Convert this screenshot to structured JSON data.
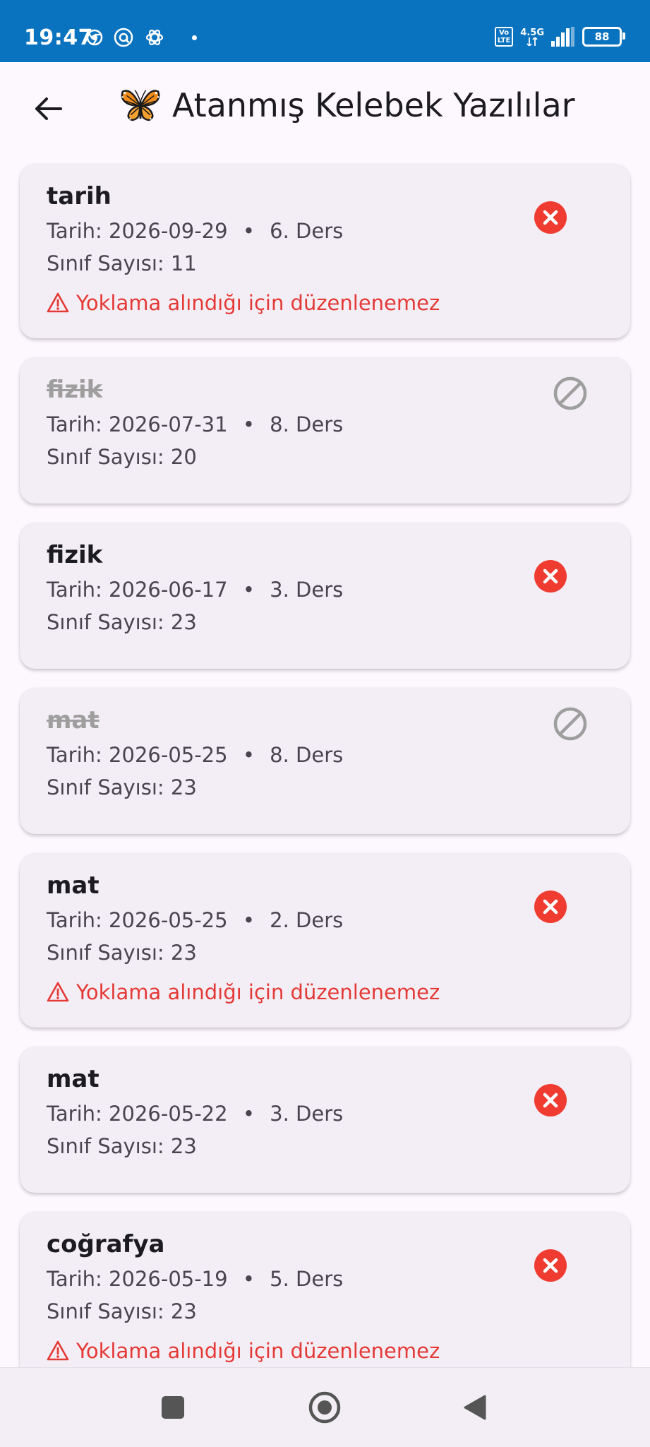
{
  "status_bar": {
    "time": "19:47",
    "network": "4.5G",
    "volte_top": "Vo",
    "volte_bottom": "LTE",
    "battery": "88"
  },
  "app_bar": {
    "title": "Atanmış Kelebek Yazılılar",
    "back_icon": "arrow-left-icon",
    "logo_icon": "butterfly-emoji"
  },
  "labels": {
    "date_prefix": "Tarih:",
    "class_count_prefix": "Sınıf Sayısı:",
    "separator": "•",
    "warning": "Yoklama alındığı için düzenlenemez"
  },
  "exams": [
    {
      "subject": "tarih",
      "date": "2026-09-29",
      "period": "6. Ders",
      "class_count": "11",
      "status": "active",
      "warning": true
    },
    {
      "subject": "fizik",
      "date": "2026-07-31",
      "period": "8. Ders",
      "class_count": "20",
      "status": "cancelled",
      "warning": false
    },
    {
      "subject": "fizik",
      "date": "2026-06-17",
      "period": "3. Ders",
      "class_count": "23",
      "status": "active",
      "warning": false
    },
    {
      "subject": "mat",
      "date": "2026-05-25",
      "period": "8. Ders",
      "class_count": "23",
      "status": "cancelled",
      "warning": false
    },
    {
      "subject": "mat",
      "date": "2026-05-25",
      "period": "2. Ders",
      "class_count": "23",
      "status": "active",
      "warning": true
    },
    {
      "subject": "mat",
      "date": "2026-05-22",
      "period": "3. Ders",
      "class_count": "23",
      "status": "active",
      "warning": false
    },
    {
      "subject": "coğrafya",
      "date": "2026-05-19",
      "period": "5. Ders",
      "class_count": "23",
      "status": "active",
      "warning": true
    }
  ],
  "colors": {
    "status_bar": "#0A73C0",
    "background": "#FDF7FE",
    "card": "#F3EEF6",
    "error": "#E53935",
    "disabled": "#9E9E9E"
  }
}
